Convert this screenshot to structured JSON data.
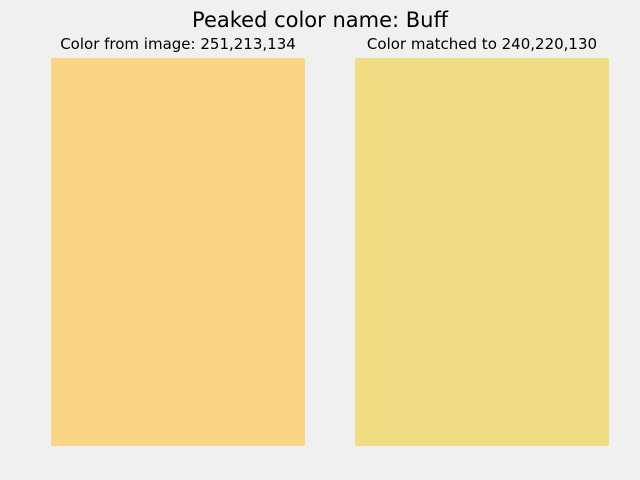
{
  "title": "Peaked color name: Buff",
  "panels": {
    "source": {
      "label": "Color from image: 251,213,134",
      "color": "#FBD586"
    },
    "matched": {
      "label": "Color matched to 240,220,130",
      "color": "#F0DC82"
    }
  }
}
